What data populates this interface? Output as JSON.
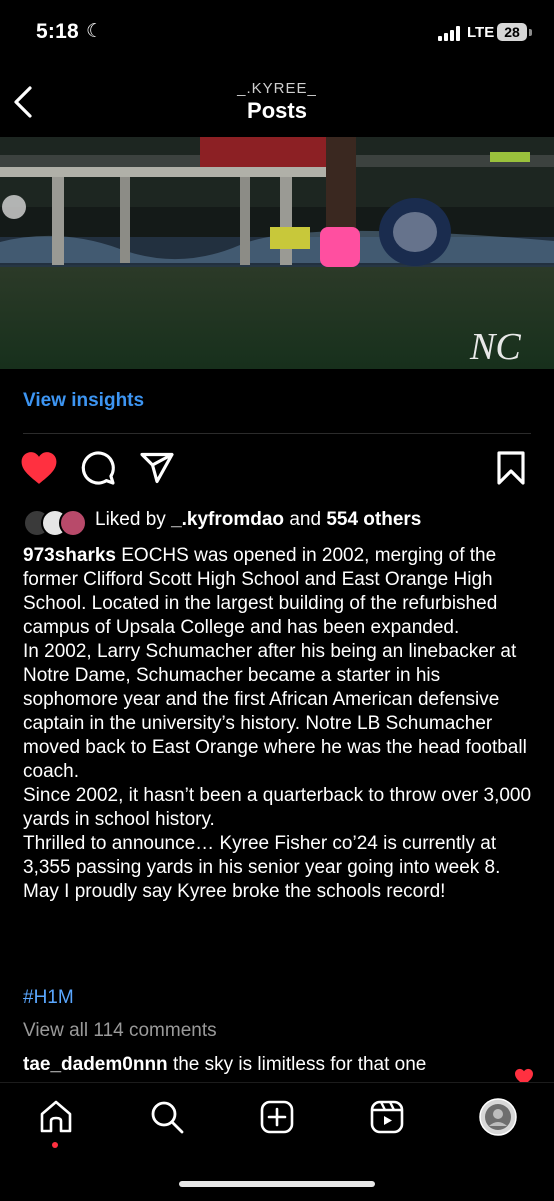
{
  "status": {
    "time": "5:18",
    "network": "LTE",
    "battery": "28"
  },
  "header": {
    "username": "_.KYREE_",
    "title": "Posts"
  },
  "photo": {
    "watermark": "NC"
  },
  "insights": {
    "label": "View insights"
  },
  "actions": {
    "liked": true
  },
  "likes": {
    "prefix": "Liked by",
    "user": "_.kyfromdao",
    "joiner": "and",
    "others": "554 others"
  },
  "caption": {
    "username": "973sharks",
    "first": "EOCHS was opened in 2002, merging of the former Clifford Scott High School and East Orange High School. Located in the largest building of the refurbished campus of Upsala College and has been expanded.",
    "p2": "In 2002, Larry Schumacher after his being an linebacker at Notre Dame, Schumacher became a starter in his sophomore year and the first African American defensive captain in the university’s history. Notre LB Schumacher moved back to East Orange where he was the head football coach.",
    "p3": "Since 2002, it hasn’t been a quarterback to throw over 3,000 yards in school history.",
    "p4": "Thrilled to announce… Kyree Fisher co’24 is currently at 3,355 passing yards in his senior year going into week 8. May I proudly say Kyree broke the schools record!"
  },
  "hashtag": "#H1M",
  "comments": {
    "view_all": "View all 114 comments",
    "preview": {
      "user": "tae_dadem0nnn",
      "text": "the sky is limitless for that one"
    }
  },
  "colors": {
    "accent": "#3d95f2",
    "like": "#ff3040",
    "hashtag": "#5aa7ff"
  }
}
